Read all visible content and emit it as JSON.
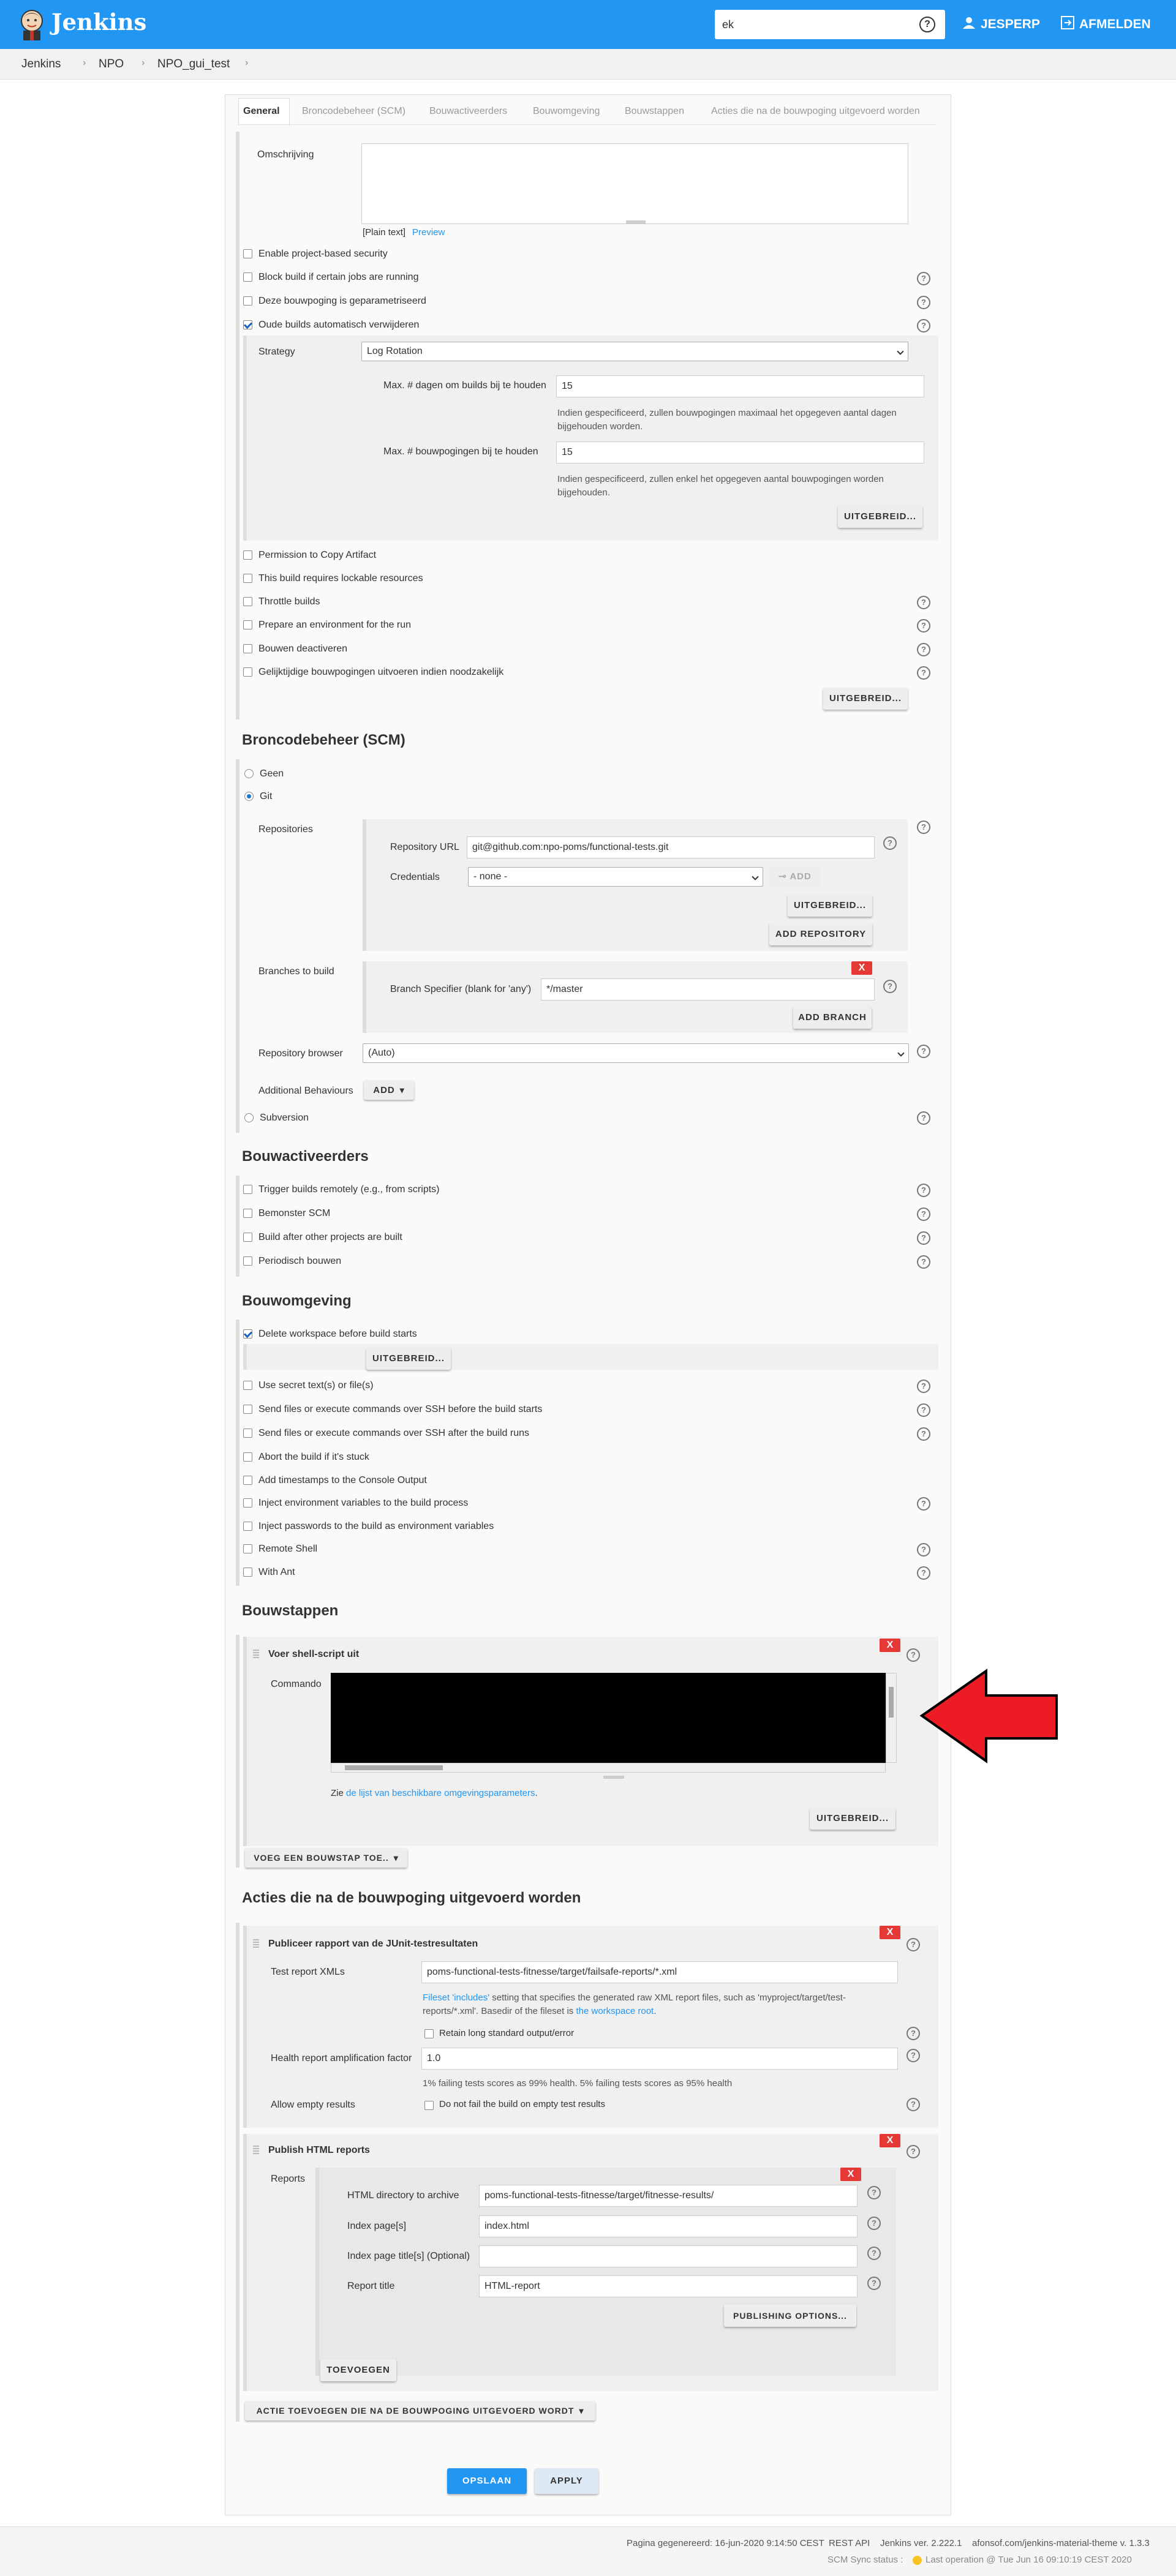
{
  "header": {
    "app_name": "Jenkins",
    "search_value": "ek",
    "user_label": "JESPERP",
    "logout_label": "AFMELDEN",
    "help_glyph": "?"
  },
  "breadcrumb": [
    "Jenkins",
    "NPO",
    "NPO_gui_test"
  ],
  "tabs": [
    "General",
    "Broncodebeheer (SCM)",
    "Bouwactiveerders",
    "Bouwomgeving",
    "Bouwstappen",
    "Acties die na de bouwpoging uitgevoerd worden"
  ],
  "general": {
    "description_label": "Omschrijving",
    "plain_text": "[Plain text]",
    "preview_link": "Preview",
    "options_top": [
      {
        "label": "Enable project-based security",
        "checked": false,
        "help": false
      },
      {
        "label": "Block build if certain jobs are running",
        "checked": false,
        "help": true
      },
      {
        "label": "Deze bouwpoging is geparametriseerd",
        "checked": false,
        "help": true
      },
      {
        "label": "Oude builds automatisch verwijderen",
        "checked": true,
        "help": true
      }
    ],
    "strategy_label": "Strategy",
    "strategy_value": "Log Rotation",
    "days_label": "Max. # dagen om builds bij te houden",
    "days_value": "15",
    "days_hint": "Indien gespecificeerd, zullen bouwpogingen maximaal het opgegeven aantal dagen bijgehouden worden.",
    "builds_label": "Max. # bouwpogingen bij te houden",
    "builds_value": "15",
    "builds_hint": "Indien gespecificeerd, zullen enkel het opgegeven aantal bouwpogingen worden bijgehouden.",
    "advanced_label": "UITGEBREID...",
    "options_bottom": [
      {
        "label": "Permission to Copy Artifact",
        "checked": false,
        "help": false
      },
      {
        "label": "This build requires lockable resources",
        "checked": false,
        "help": false
      },
      {
        "label": "Throttle builds",
        "checked": false,
        "help": true
      },
      {
        "label": "Prepare an environment for the run",
        "checked": false,
        "help": true
      },
      {
        "label": "Bouwen deactiveren",
        "checked": false,
        "help": true
      },
      {
        "label": "Gelijktijdige bouwpogingen uitvoeren indien noodzakelijk",
        "checked": false,
        "help": true
      }
    ],
    "advanced_label_2": "UITGEBREID..."
  },
  "scm": {
    "title": "Broncodebeheer (SCM)",
    "none_label": "Geen",
    "git_label": "Git",
    "repositories_label": "Repositories",
    "repo_url_label": "Repository URL",
    "repo_url_value": "git@github.com:npo-poms/functional-tests.git",
    "credentials_label": "Credentials",
    "credentials_value": "- none -",
    "add_label": "ADD",
    "advanced_label": "UITGEBREID...",
    "add_repository_label": "ADD REPOSITORY",
    "branches_label": "Branches to build",
    "branch_specifier_label": "Branch Specifier (blank for 'any')",
    "branch_specifier_value": "*/master",
    "add_branch_label": "ADD BRANCH",
    "browser_label": "Repository browser",
    "browser_value": "(Auto)",
    "behaviours_label": "Additional Behaviours",
    "behaviours_add": "ADD",
    "subversion_label": "Subversion",
    "x_label": "X"
  },
  "triggers": {
    "title": "Bouwactiveerders",
    "options": [
      {
        "label": "Trigger builds remotely (e.g., from scripts)",
        "checked": false
      },
      {
        "label": "Bemonster SCM",
        "checked": false
      },
      {
        "label": "Build after other projects are built",
        "checked": false
      },
      {
        "label": "Periodisch bouwen",
        "checked": false
      }
    ]
  },
  "environment": {
    "title": "Bouwomgeving",
    "delete_ws_label": "Delete workspace before build starts",
    "advanced_label": "UITGEBREID...",
    "options": [
      {
        "label": "Use secret text(s) or file(s)",
        "checked": false,
        "help": true
      },
      {
        "label": "Send files or execute commands over SSH before the build starts",
        "checked": false,
        "help": true
      },
      {
        "label": "Send files or execute commands over SSH after the build runs",
        "checked": false,
        "help": true
      },
      {
        "label": "Abort the build if it's stuck",
        "checked": false,
        "help": false
      },
      {
        "label": "Add timestamps to the Console Output",
        "checked": false,
        "help": false
      },
      {
        "label": "Inject environment variables to the build process",
        "checked": false,
        "help": true
      },
      {
        "label": "Inject passwords to the build as environment variables",
        "checked": false,
        "help": false
      },
      {
        "label": "Remote Shell",
        "checked": false,
        "help": true
      },
      {
        "label": "With Ant",
        "checked": false,
        "help": true
      }
    ]
  },
  "build": {
    "title": "Bouwstappen",
    "step_title": "Voer shell-script uit",
    "command_label": "Commando",
    "see_text": "Zie",
    "env_link": "de lijst van beschikbare omgevingsparameters",
    "period": ".",
    "advanced_label": "UITGEBREID...",
    "add_step_label": "VOEG EEN BOUWSTAP TOE..",
    "x_label": "X",
    "arrow_color": "#ed1c24"
  },
  "post": {
    "title": "Acties die na de bouwpoging uitgevoerd worden",
    "junit_title": "Publiceer rapport van de JUnit-testresultaten",
    "xml_label": "Test report XMLs",
    "xml_value": "poms-functional-tests-fitnesse/target/failsafe-reports/*.xml",
    "fileset_link": "Fileset 'includes'",
    "fileset_text": " setting that specifies the generated raw XML report files, such as 'myproject/target/test-reports/*.xml'. Basedir of the fileset is ",
    "workspace_link": "the workspace root",
    "retain_label": "Retain long standard output/error",
    "health_label": "Health report amplification factor",
    "health_value": "1.0",
    "health_hint": "1% failing tests scores as 99% health. 5% failing tests scores as 95% health",
    "empty_label": "Allow empty results",
    "empty_check_label": "Do not fail the build on empty test results",
    "html_title": "Publish HTML reports",
    "reports_label": "Reports",
    "html_dir_label": "HTML directory to archive",
    "html_dir_value": "poms-functional-tests-fitnesse/target/fitnesse-results/",
    "index_label": "Index page[s]",
    "index_value": "index.html",
    "index_title_label": "Index page title[s] (Optional)",
    "index_title_value": "",
    "report_title_label": "Report title",
    "report_title_value": "HTML-report",
    "publishing_label": "PUBLISHING OPTIONS...",
    "toevoegen_label": "TOEVOEGEN",
    "add_action_label": "ACTIE TOEVOEGEN DIE NA DE BOUWPOGING UITGEVOERD WORDT",
    "x_label": "X"
  },
  "actions": {
    "save_label": "OPSLAAN",
    "apply_label": "APPLY"
  },
  "footer": {
    "generated": "Pagina gegenereerd: 16-jun-2020 9:14:50 CEST",
    "rest_api": "REST API",
    "version": "Jenkins ver. 2.222.1",
    "theme": "afonsof.com/jenkins-material-theme v. 1.3.3",
    "sync_status": "SCM Sync status :",
    "last_op": "Last operation @ Tue Jun 16 09:10:19 CEST 2020"
  },
  "colors": {
    "primary": "#2196f3",
    "danger": "#e53935",
    "arrow": "#ed1c24"
  }
}
